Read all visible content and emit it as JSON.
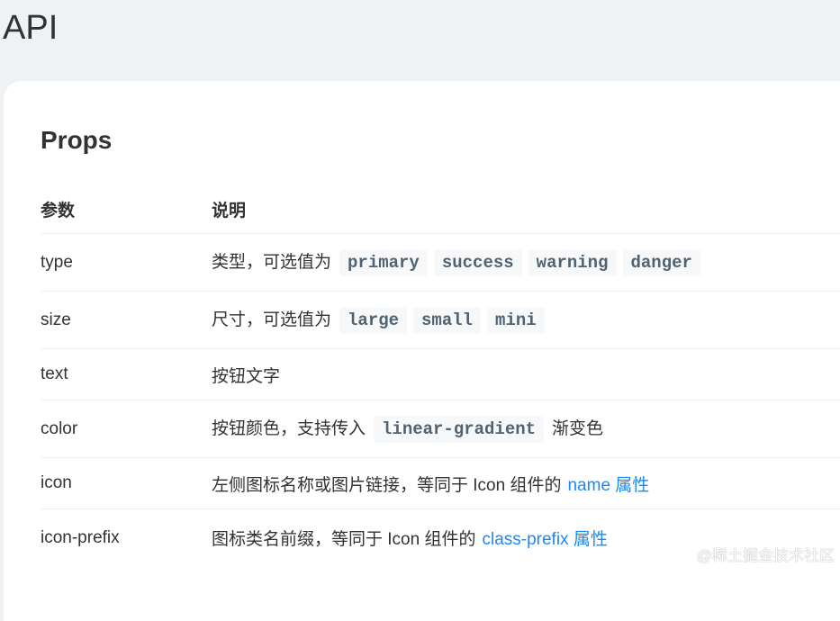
{
  "page_title": "API",
  "section_title": "Props",
  "table": {
    "headers": [
      "参数",
      "说明"
    ],
    "rows": [
      {
        "param": "type",
        "desc_prefix": "类型，可选值为",
        "tags": [
          "primary",
          "success",
          "warning",
          "danger"
        ],
        "desc_suffix": "",
        "link": ""
      },
      {
        "param": "size",
        "desc_prefix": "尺寸，可选值为",
        "tags": [
          "large",
          "small",
          "mini"
        ],
        "desc_suffix": "",
        "link": ""
      },
      {
        "param": "text",
        "desc_prefix": "按钮文字",
        "tags": [],
        "desc_suffix": "",
        "link": ""
      },
      {
        "param": "color",
        "desc_prefix": "按钮颜色，支持传入",
        "tags": [
          "linear-gradient"
        ],
        "desc_suffix": "渐变色",
        "link": ""
      },
      {
        "param": "icon",
        "desc_prefix": "左侧图标名称或图片链接，等同于 Icon 组件的",
        "tags": [],
        "desc_suffix": "",
        "link": "name 属性"
      },
      {
        "param": "icon-prefix",
        "desc_prefix": "图标类名前缀，等同于 Icon 组件的",
        "tags": [],
        "desc_suffix": "",
        "link": "class-prefix 属性"
      }
    ]
  },
  "watermark": "@稀土掘金技术社区"
}
